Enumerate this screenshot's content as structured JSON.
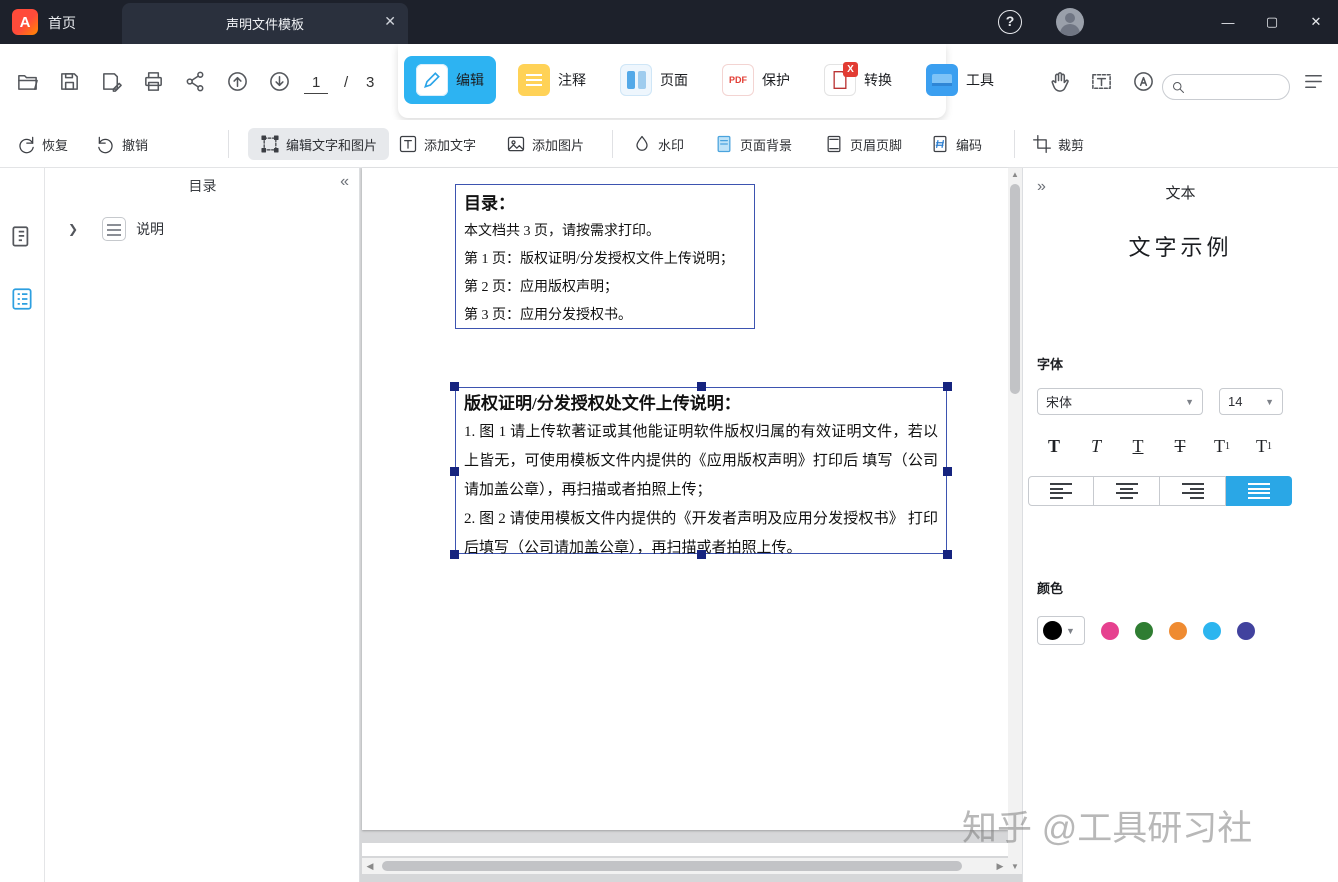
{
  "titlebar": {
    "logo": "A",
    "home_label": "首页",
    "tab_title": "声明文件模板",
    "close_tab": "✕",
    "help": "?",
    "minimize": "—",
    "maximize": "▢",
    "close": "✕"
  },
  "toolbar": {
    "page_current": "1",
    "page_separator": "/",
    "page_total": "3",
    "ribbon_tabs": [
      {
        "label": "编辑",
        "active": true
      },
      {
        "label": "注释",
        "active": false
      },
      {
        "label": "页面",
        "active": false
      },
      {
        "label": "保护",
        "active": false
      },
      {
        "label": "转换",
        "active": false
      },
      {
        "label": "工具",
        "active": false
      }
    ]
  },
  "edit_bar": {
    "redo_label": "恢复",
    "undo_label": "撤销",
    "edit_text_image": "编辑文字和图片",
    "add_text": "添加文字",
    "add_image": "添加图片",
    "watermark": "水印",
    "page_background": "页面背景",
    "header_footer": "页眉页脚",
    "encode": "编码",
    "crop": "裁剪"
  },
  "sidebar": {
    "panel_title": "目录",
    "collapse": "«",
    "item_label": "说明"
  },
  "document": {
    "toc_title": "目录：",
    "toc_lines": [
      "本文档共 3 页，请按需求打印。",
      "第 1 页：版权证明/分发授权文件上传说明；",
      "第 2 页：应用版权声明；",
      "第 3 页：应用分发授权书。"
    ],
    "selected_title": "版权证明/分发授权处文件上传说明：",
    "selected_paragraphs": [
      "1.  图 1 请上传软著证或其他能证明软件版权归属的有效证明文件，若以上皆无，可使用模板文件内提供的《应用版权声明》打印后 填写（公司请加盖公章），再扫描或者拍照上传；",
      "2.  图 2 请使用模板文件内提供的《开发者声明及应用分发授权书》 打印后填写（公司请加盖公章），再扫描或者拍照上传。"
    ],
    "watermark": "知乎 @工具研习社"
  },
  "right_panel": {
    "expand": "»",
    "title": "文本",
    "sample_text": "文字示例",
    "font_label": "字体",
    "font_family": "宋体",
    "font_size": "14",
    "style_glyphs": [
      "T",
      "T",
      "T",
      "T",
      "T",
      "T"
    ],
    "color_label": "颜色",
    "current_color": "#000000",
    "swatches": [
      "#e6418f",
      "#2f7d32",
      "#ef8b31",
      "#2cb5ef",
      "#41429e"
    ]
  }
}
